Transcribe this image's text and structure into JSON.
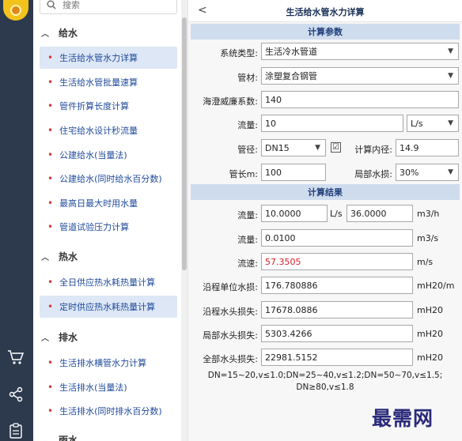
{
  "search": {
    "placeholder": "搜索"
  },
  "sidebar": {
    "sections": [
      {
        "label": "给水",
        "items": [
          "生活给水管水力详算",
          "生活给水管批量速算",
          "管件折算长度计算",
          "住宅给水设计秒流量",
          "公建给水(当量法)",
          "公建给水(同时给水百分数)",
          "最高日最大时用水量",
          "管道试验压力计算"
        ]
      },
      {
        "label": "热水",
        "items": [
          "全日供应热水耗热量计算",
          "定时供应热水耗热量计算"
        ]
      },
      {
        "label": "排水",
        "items": [
          "生活排水横管水力计算",
          "生活排水(当量法)",
          "生活排水(同时排水百分数)"
        ]
      },
      {
        "label": "雨水",
        "items": []
      }
    ]
  },
  "header": {
    "back": "<",
    "title": "生活给水管水力详算"
  },
  "params": {
    "band": "计算参数",
    "system_type_label": "系统类型:",
    "system_type_value": "生活冷水管道",
    "material_label": "管材:",
    "material_value": "涂塑复合钢管",
    "hazen_label": "海澄威廉系数:",
    "hazen_value": "140",
    "flow_label": "流量:",
    "flow_value": "10",
    "flow_unit": "L/s",
    "diameter_label": "管径:",
    "diameter_value": "DN15",
    "inner_checked": "☑",
    "inner_label": "计算内径:",
    "inner_value": "14.9",
    "length_label": "管长m:",
    "length_value": "100",
    "local_loss_label": "局部水损:",
    "local_loss_value": "30%"
  },
  "results": {
    "band": "计算结果",
    "flow_label": "流量:",
    "flow_ls": "10.0000",
    "flow_ls_unit": "L/s",
    "flow_m3h": "36.0000",
    "flow_m3h_unit": "m3/h",
    "flow2_label": "流量:",
    "flow2_value": "0.0100",
    "flow2_unit": "m3/s",
    "velocity_label": "流速:",
    "velocity_value": "57.3505",
    "velocity_unit": "m/s",
    "unit_loss_label": "沿程单位水损:",
    "unit_loss_value": "176.780886",
    "unit_loss_unit": "mH20/m",
    "along_loss_label": "沿程水头损失:",
    "along_loss_value": "17678.0886",
    "along_loss_unit": "mH20",
    "local_loss_label": "局部水头损失:",
    "local_loss_value": "5303.4266",
    "local_loss_unit": "mH20",
    "total_loss_label": "全部水头损失:",
    "total_loss_value": "22981.5152",
    "total_loss_unit": "mH20",
    "note_line1": "DN=15~20,v≤1.0;DN=25~40,v≤1.2;DN=50~70,v≤1.5;",
    "note_line2": "DN≥80,v≤1.8"
  },
  "watermark": "最需网",
  "colors": {
    "rail": "#2d3a4e",
    "accent": "#1f4a9b",
    "band": "#cfdcee",
    "alert": "#d6202c"
  }
}
